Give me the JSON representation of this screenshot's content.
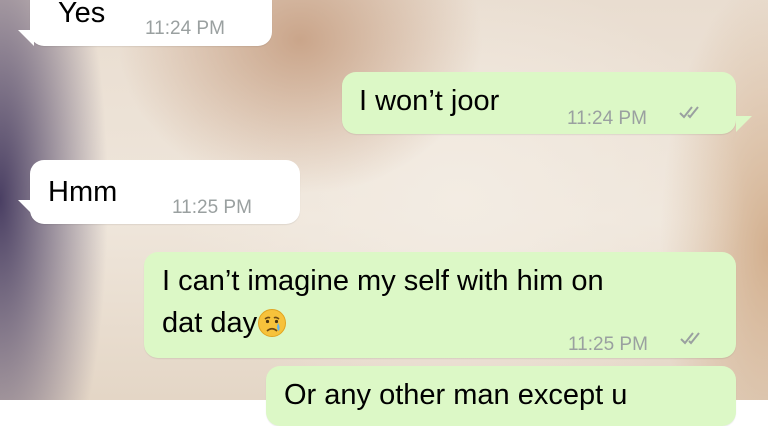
{
  "colors": {
    "incoming_bubble": "#ffffff",
    "outgoing_bubble": "#dcf8c6",
    "timestamp": "#9aa0a0",
    "read_ticks": "#9aa0a0"
  },
  "messages": [
    {
      "direction": "incoming",
      "text": "Yes",
      "time": "11:24 PM"
    },
    {
      "direction": "outgoing",
      "text": "I won’t joor",
      "time": "11:24 PM",
      "status": "double-check-icon"
    },
    {
      "direction": "incoming",
      "text": "Hmm",
      "time": "11:25 PM"
    },
    {
      "direction": "outgoing",
      "text_line1": "I can’t imagine my self with him on",
      "text_line2": "dat day",
      "emoji": "crying-face-emoji",
      "time": "11:25 PM",
      "status": "double-check-icon"
    },
    {
      "direction": "outgoing",
      "text": "Or any other man except u"
    }
  ]
}
